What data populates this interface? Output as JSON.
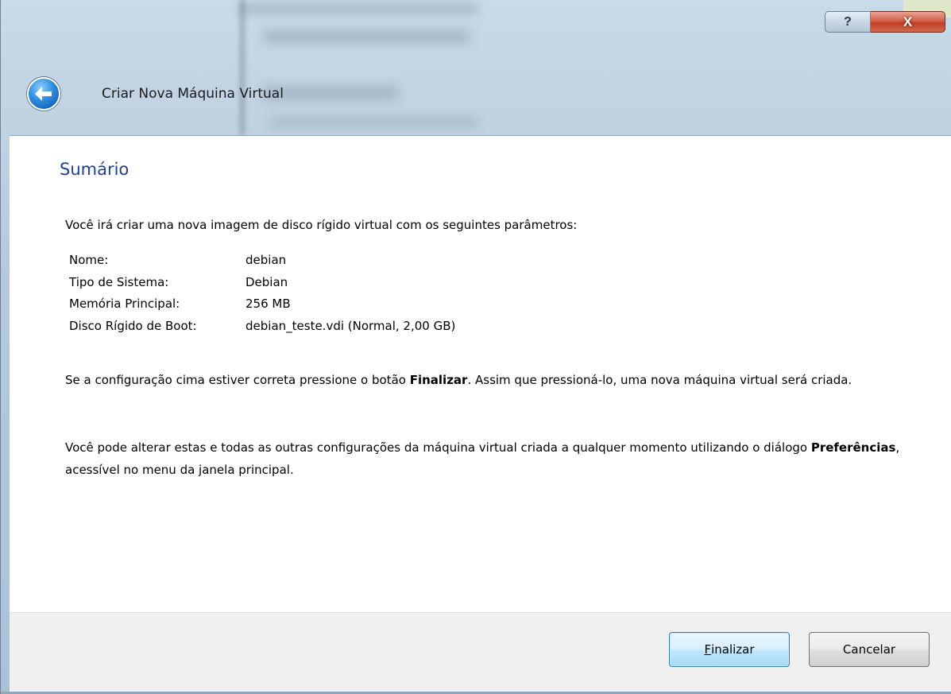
{
  "window": {
    "title": "Criar Nova Máquina Virtual",
    "help_glyph": "?",
    "close_glyph": "X"
  },
  "page": {
    "heading": "Sumário",
    "intro": "Você irá criar uma nova imagem de disco rígido virtual com os seguintes parâmetros:",
    "params": [
      {
        "label": "Nome:",
        "value": "debian"
      },
      {
        "label": "Tipo de Sistema:",
        "value": "Debian"
      },
      {
        "label": "Memória Principal:",
        "value": "256 MB"
      },
      {
        "label": "Disco Rígido de Boot:",
        "value": "debian_teste.vdi (Normal, 2,00 GB)"
      }
    ],
    "para1_pre": "Se a configuração cima estiver correta pressione o botão ",
    "para1_bold": "Finalizar",
    "para1_post": ". Assim que pressioná-lo, uma nova máquina virtual será criada.",
    "para2_pre": "Você pode alterar estas e todas as outras configurações da máquina virtual criada a qualquer momento utilizando o diálogo ",
    "para2_bold": "Preferências",
    "para2_post": ", acessível no menu da janela principal."
  },
  "buttons": {
    "finish_mnemonic": "F",
    "finish_rest": "inalizar",
    "cancel": "Cancelar"
  },
  "colors": {
    "heading": "#1e3f9b",
    "close_button": "#c03d24",
    "default_button_border": "#3c7fb1"
  }
}
